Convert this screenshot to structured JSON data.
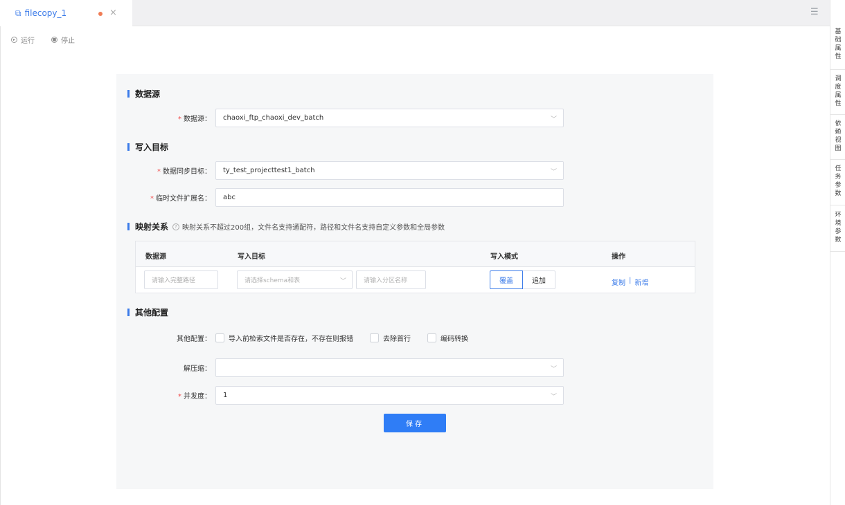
{
  "tab": {
    "title": "filecopy_1",
    "icon": "copy-icon",
    "close": "×",
    "unsaved_color": "#f07c55"
  },
  "toolbar": {
    "run_label": "运行",
    "stop_label": "停止"
  },
  "right_rail": [
    {
      "label": "基础属性"
    },
    {
      "label": "调度属性"
    },
    {
      "label": "依赖视图"
    },
    {
      "label": "任务参数"
    },
    {
      "label": "环境参数"
    }
  ],
  "sections": {
    "datasource": "数据源",
    "target": "写入目标",
    "mapping": "映射关系",
    "mapping_help": "映射关系不超过200组，文件名支持通配符，路径和文件名支持自定义参数和全局参数",
    "other": "其他配置"
  },
  "form": {
    "datasource_label": "数据源：",
    "datasource_value": "chaoxi_ftp_chaoxi_dev_batch",
    "sync_target_label": "数据同步目标：",
    "sync_target_value": "ty_test_projecttest1_batch",
    "temp_ext_label": "临时文件扩展名：",
    "temp_ext_value": "abc",
    "other_label": "其他配置：",
    "checkboxes": [
      {
        "label": "导入前检索文件是否存在，不存在则报错",
        "checked": false
      },
      {
        "label": "去除首行",
        "checked": false
      },
      {
        "label": "编码转换",
        "checked": false
      }
    ],
    "decompress_label": "解压缩：",
    "decompress_value": "",
    "concurrency_label": "并发度：",
    "concurrency_value": "1",
    "save_label": "保存"
  },
  "mapping_table": {
    "headers": [
      "数据源",
      "写入目标",
      "写入模式",
      "操作"
    ],
    "row": {
      "path_placeholder": "请输入完整路径",
      "schema_placeholder": "请选择schema和表",
      "partition_placeholder": "请输入分区名称",
      "mode_options": [
        "覆盖",
        "追加"
      ],
      "mode_selected": "覆盖",
      "ops": [
        "复制",
        "新增"
      ],
      "ops_sep": "|"
    }
  },
  "colors": {
    "accent": "#3b7be9",
    "required": "#f04b4b",
    "button": "#2f7df6"
  }
}
